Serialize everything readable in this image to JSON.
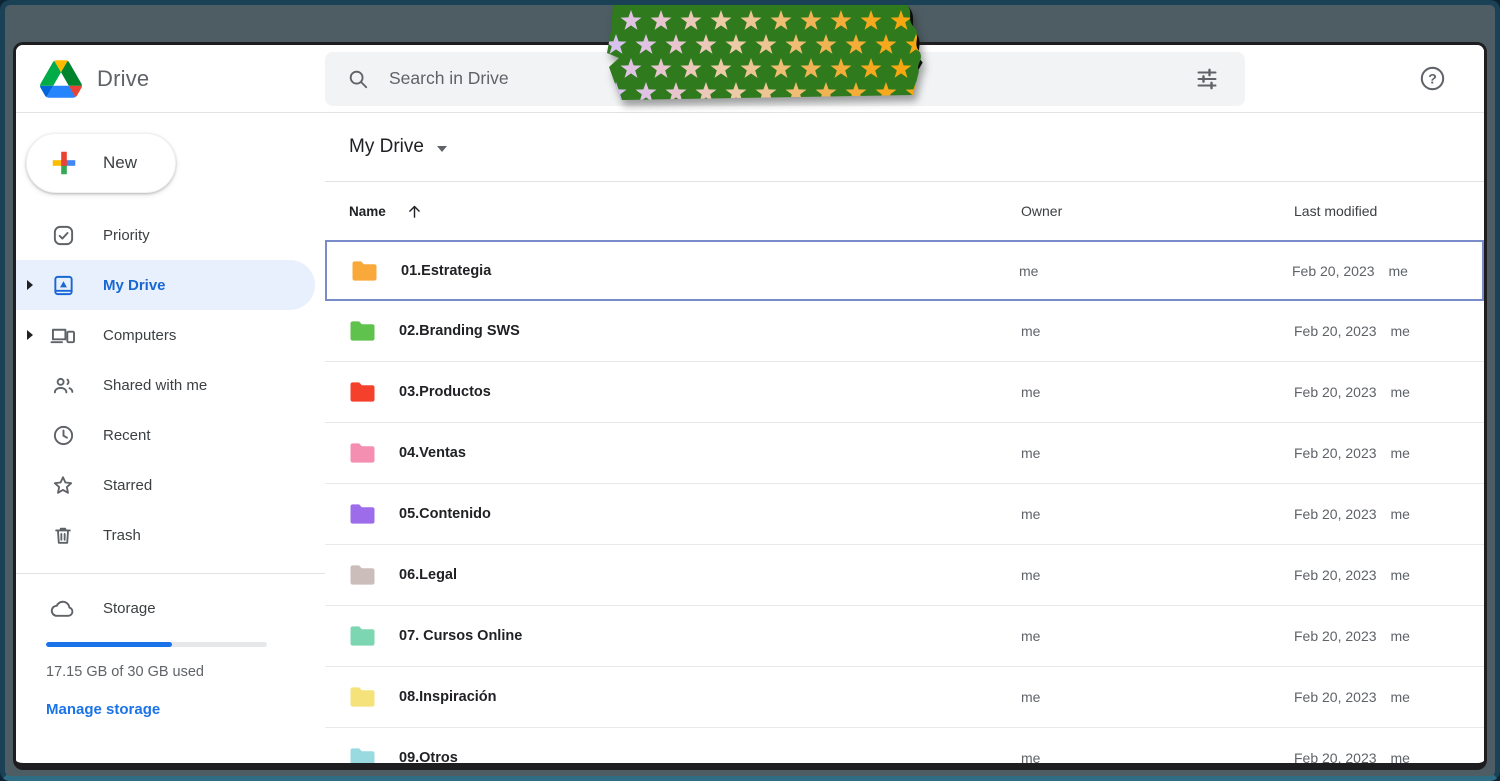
{
  "header": {
    "app_name": "Drive",
    "search_placeholder": "Search in Drive"
  },
  "sidebar": {
    "new_button": "New",
    "items": [
      {
        "id": "priority",
        "label": "Priority",
        "selected": false,
        "expandable": false
      },
      {
        "id": "my-drive",
        "label": "My Drive",
        "selected": true,
        "expandable": true
      },
      {
        "id": "computers",
        "label": "Computers",
        "selected": false,
        "expandable": true
      },
      {
        "id": "shared-with-me",
        "label": "Shared with me",
        "selected": false,
        "expandable": false
      },
      {
        "id": "recent",
        "label": "Recent",
        "selected": false,
        "expandable": false
      },
      {
        "id": "starred",
        "label": "Starred",
        "selected": false,
        "expandable": false
      },
      {
        "id": "trash",
        "label": "Trash",
        "selected": false,
        "expandable": false
      }
    ],
    "storage": {
      "label": "Storage",
      "percent_used": 57,
      "usage_text": "17.15 GB of 30 GB used",
      "manage_link": "Manage storage"
    }
  },
  "content": {
    "title": "My Drive",
    "columns": {
      "name": "Name",
      "owner": "Owner",
      "last_modified": "Last modified"
    },
    "sort": {
      "column": "name",
      "direction": "ascending"
    },
    "rows": [
      {
        "name": "01.Estrategia",
        "folder_color": "#F9A93A",
        "owner": "me",
        "last_modified": "Feb 20, 2023",
        "modified_by": "me",
        "selected": true
      },
      {
        "name": "02.Branding SWS",
        "folder_color": "#5FC24D",
        "owner": "me",
        "last_modified": "Feb 20, 2023",
        "modified_by": "me",
        "selected": false
      },
      {
        "name": "03.Productos",
        "folder_color": "#F5402C",
        "owner": "me",
        "last_modified": "Feb 20, 2023",
        "modified_by": "me",
        "selected": false
      },
      {
        "name": "04.Ventas",
        "folder_color": "#F48FB1",
        "owner": "me",
        "last_modified": "Feb 20, 2023",
        "modified_by": "me",
        "selected": false
      },
      {
        "name": "05.Contenido",
        "folder_color": "#9C6CEB",
        "owner": "me",
        "last_modified": "Feb 20, 2023",
        "modified_by": "me",
        "selected": false
      },
      {
        "name": "06.Legal",
        "folder_color": "#CBBDBA",
        "owner": "me",
        "last_modified": "Feb 20, 2023",
        "modified_by": "me",
        "selected": false
      },
      {
        "name": "07. Cursos Online",
        "folder_color": "#7DD6B2",
        "owner": "me",
        "last_modified": "Feb 20, 2023",
        "modified_by": "me",
        "selected": false
      },
      {
        "name": "08.Inspiración",
        "folder_color": "#F6E27B",
        "owner": "me",
        "last_modified": "Feb 20, 2023",
        "modified_by": "me",
        "selected": false
      },
      {
        "name": "09.Otros",
        "folder_color": "#99D9E0",
        "owner": "me",
        "last_modified": "Feb 20, 2023",
        "modified_by": "me",
        "selected": false
      }
    ]
  },
  "colors": {
    "accent_blue": "#1a73e8",
    "selected_sidebar_bg": "#e8f0fe",
    "selected_sidebar_text": "#1967d2",
    "row_selection_border": "#7a8bc9",
    "search_bg": "#f1f3f4",
    "top_strip": "#4d5d63",
    "outer_frame": "#1b4156"
  },
  "overlay": {
    "kind": "green-star-sticker",
    "green": "#2e7a1d",
    "star_colors": [
      "#d9c2ef",
      "#e0c3e2",
      "#e8c4cf",
      "#ebc8b8",
      "#eccba6",
      "#edc594",
      "#efbd74",
      "#f1b455",
      "#f4ad38",
      "#f6a81f",
      "#f7a712"
    ]
  }
}
